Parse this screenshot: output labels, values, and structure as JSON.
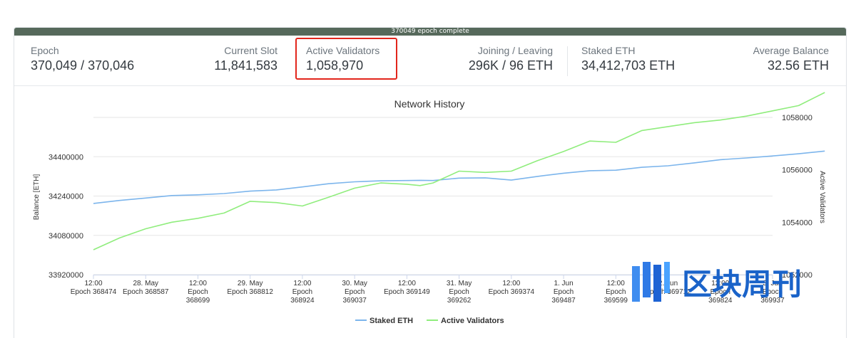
{
  "progress": {
    "label": "370049 epoch complete",
    "fraction": 1.0,
    "color": "#56695b"
  },
  "stats": {
    "epoch": {
      "label": "Epoch",
      "value": "370,049 / 370,046"
    },
    "current_slot": {
      "label": "Current Slot",
      "value": "11,841,583"
    },
    "active_validators": {
      "label": "Active Validators",
      "value": "1,058,970"
    },
    "joining_leaving": {
      "label": "Joining / Leaving",
      "value": "296K / 96 ETH"
    },
    "staked_eth": {
      "label": "Staked ETH",
      "value": "34,412,703 ETH"
    },
    "average_balance": {
      "label": "Average Balance",
      "value": "32.56 ETH"
    }
  },
  "highlight_color": "#e2261c",
  "watermark": {
    "text": "区块周刊",
    "color": "#1a63c9"
  },
  "chart_data": {
    "type": "line",
    "title": "Network History",
    "ylabel": "Balance [ETH]",
    "y2label": "Active Validators",
    "ylim": [
      33920000,
      34560000
    ],
    "y2lim": [
      1052000,
      1058000
    ],
    "yticks": [
      "34400000",
      "34240000",
      "34080000",
      "33920000"
    ],
    "y2ticks": [
      "1058000",
      "1056000",
      "1054000",
      "1052000"
    ],
    "xticks": [
      [
        "12:00",
        "Epoch 368474"
      ],
      [
        "28. May",
        "Epoch 368587"
      ],
      [
        "12:00",
        "Epoch",
        "368699"
      ],
      [
        "29. May",
        "Epoch 368812"
      ],
      [
        "12:00",
        "Epoch",
        "368924"
      ],
      [
        "30. May",
        "Epoch",
        "369037"
      ],
      [
        "12:00",
        "Epoch 369149"
      ],
      [
        "31. May",
        "Epoch",
        "369262"
      ],
      [
        "12:00",
        "Epoch 369374"
      ],
      [
        "1. Jun",
        "Epoch",
        "369487"
      ],
      [
        "12:00",
        "Epoch",
        "369599"
      ],
      [
        "2. Jun",
        "Epoch 369712"
      ],
      [
        "12:00",
        "Epoch",
        "369824"
      ],
      [
        "3. Jun",
        "Epoch",
        "369937"
      ]
    ],
    "x": [
      0,
      0.5,
      1,
      1.5,
      2,
      2.5,
      3,
      3.5,
      4,
      4.5,
      5,
      5.5,
      6,
      6.25,
      6.5,
      7,
      7.5,
      8,
      8.5,
      9,
      9.5,
      10,
      10.5,
      11,
      11.5,
      12,
      12.5,
      13,
      13.5,
      14
    ],
    "series": [
      {
        "name": "Staked ETH",
        "axis": "left",
        "color": "#7cb5ec",
        "values": [
          34210000,
          34222000,
          34232000,
          34242000,
          34245000,
          34250000,
          34260000,
          34265000,
          34277000,
          34290000,
          34298000,
          34302000,
          34303000,
          34304000,
          34303000,
          34313000,
          34314000,
          34305000,
          34320000,
          34333000,
          34343000,
          34345000,
          34357000,
          34363000,
          34375000,
          34388000,
          34395000,
          34403000,
          34412000,
          34423000
        ]
      },
      {
        "name": "Active Validators",
        "axis": "right",
        "color": "#90ed7d",
        "values": [
          1052950,
          1053400,
          1053750,
          1054000,
          1054150,
          1054350,
          1054800,
          1054750,
          1054620,
          1054950,
          1055300,
          1055500,
          1055450,
          1055400,
          1055500,
          1055950,
          1055900,
          1055950,
          1056350,
          1056700,
          1057100,
          1057050,
          1057500,
          1057650,
          1057800,
          1057900,
          1058050,
          1058250,
          1058450,
          1058950
        ]
      }
    ],
    "legend_position": "bottom-center"
  }
}
